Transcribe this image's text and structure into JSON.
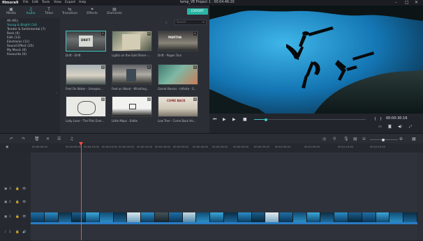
{
  "app": {
    "logo": "filmora9",
    "title": "temp_VE Project 1 : 00:04:46:20"
  },
  "menu": [
    "File",
    "Edit",
    "Tools",
    "View",
    "Export",
    "Help"
  ],
  "window_controls": [
    "–",
    "□",
    "✕"
  ],
  "tabs": [
    {
      "label": "Media",
      "icon": "media-icon"
    },
    {
      "label": "Audio",
      "icon": "audio-icon"
    },
    {
      "label": "Titles",
      "icon": "titles-icon"
    },
    {
      "label": "Transition",
      "icon": "transition-icon"
    },
    {
      "label": "Effects",
      "icon": "effects-icon"
    },
    {
      "label": "Elements",
      "icon": "elements-icon"
    }
  ],
  "export_label": "EXPORT",
  "categories": [
    {
      "label": "All (91)"
    },
    {
      "label": "Young & Bright (14)"
    },
    {
      "label": "Tender & Sentimental (7)"
    },
    {
      "label": "Rock (6)"
    },
    {
      "label": "Folk (13)"
    },
    {
      "label": "Electronic (11)"
    },
    {
      "label": "Sound Effect (25)"
    },
    {
      "label": "My Music (0)"
    },
    {
      "label": "Favourite (0)"
    }
  ],
  "search": {
    "placeholder": "Search"
  },
  "audio_items": [
    {
      "caption": "Drift - Drift",
      "selected": true
    },
    {
      "caption": "Lights on the Gold Shore -...",
      "selected": false
    },
    {
      "caption": "Drift - Pages Turn",
      "selected": false
    },
    {
      "caption": "Feet On Water - Unexpec...",
      "selected": false
    },
    {
      "caption": "Feet on Wood - Whistling...",
      "selected": false
    },
    {
      "caption": "Garret Bevins - Infinite - S...",
      "selected": false
    },
    {
      "caption": "Lady Lane - The Pink Ever...",
      "selected": false
    },
    {
      "caption": "Little Maps - Eddie",
      "selected": false
    },
    {
      "caption": "Low Tree - Come Back Ho...",
      "selected": false
    }
  ],
  "player": {
    "timecode": "00:00:30:16",
    "progress": 0.1
  },
  "ruler_labels": [
    "00:00:00:00",
    "00:00:05:00",
    "00:00:10:00",
    "00:00:15:00",
    "00:00:20:00",
    "00:00:25:00",
    "00:00:30:00",
    "00:00:35:00",
    "00:00:40:00",
    "00:00:45:00",
    "00:00:50:00",
    "00:00:55:00",
    "00:01:00:00",
    "00:01:05:00",
    "00:01:10:00",
    "00:01:15:00"
  ],
  "track_labels": [
    "3",
    "2",
    "1",
    "1"
  ]
}
